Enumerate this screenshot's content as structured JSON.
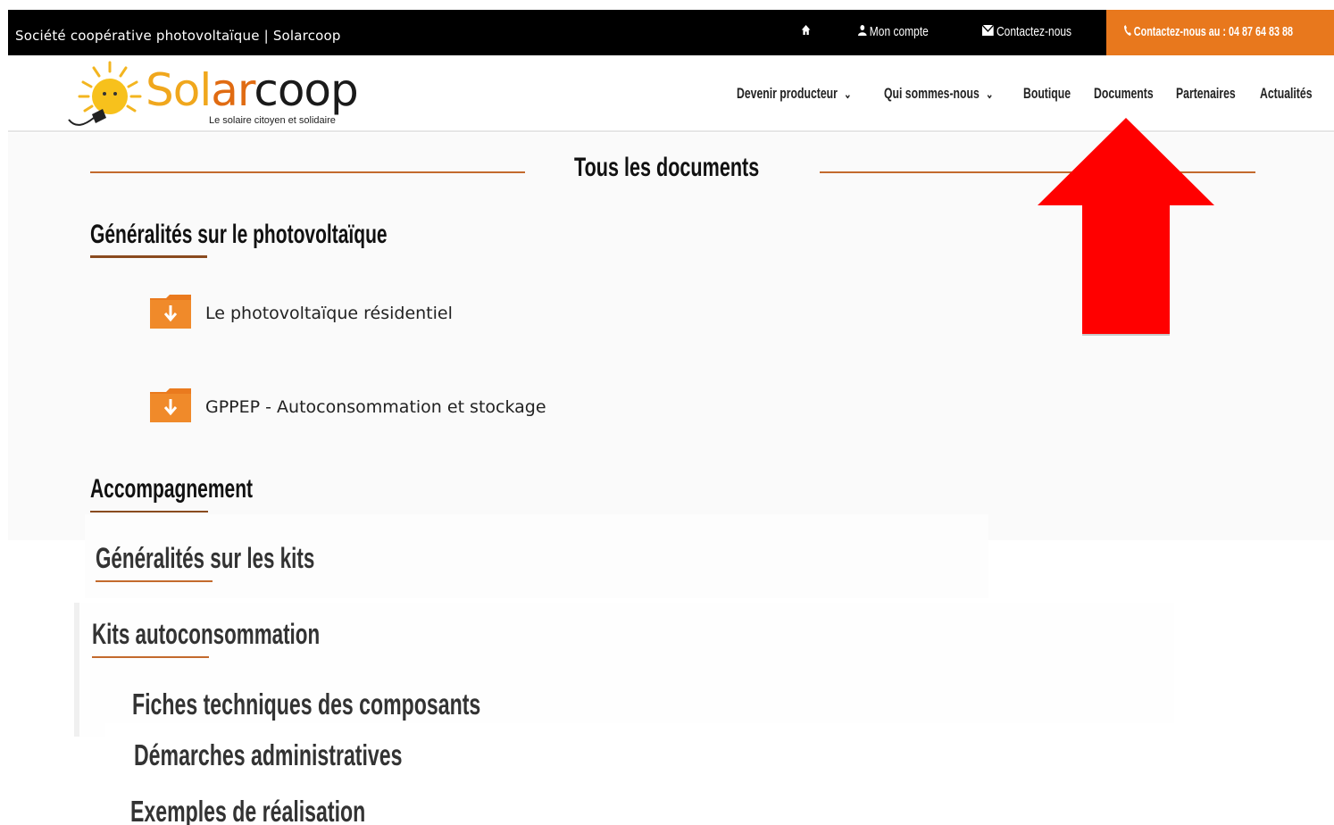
{
  "topbar": {
    "tagline": "Société coopérative photovoltaïque | Solarcoop",
    "home_icon": "home-icon",
    "account_label": "Mon compte",
    "account_icon": "user-icon",
    "contact_label": "Contactez-nous",
    "contact_icon": "envelope-icon",
    "phone_label": "Contactez-nous au : 04 87 64 83 88",
    "phone_icon": "phone-icon",
    "phone_bg": "#e8781d"
  },
  "logo": {
    "part1": "Sol",
    "part2": "ar",
    "part3": "coop",
    "slogan": "Le solaire citoyen et solidaire"
  },
  "nav": {
    "items": [
      {
        "label": "Devenir producteur",
        "has_dropdown": true
      },
      {
        "label": "Qui sommes-nous",
        "has_dropdown": true
      },
      {
        "label": "Boutique",
        "has_dropdown": false
      },
      {
        "label": "Documents",
        "has_dropdown": false
      },
      {
        "label": "Partenaires",
        "has_dropdown": false
      },
      {
        "label": "Actualités",
        "has_dropdown": false
      }
    ]
  },
  "page": {
    "title": "Tous les documents",
    "sections": [
      {
        "title": "Généralités sur le photovoltaïque",
        "documents": [
          "Le photovoltaïque résidentiel",
          "GPPEP - Autoconsommation et stockage"
        ]
      },
      {
        "title": "Accompagnement"
      }
    ],
    "lower_sections": [
      "Généralités sur les kits",
      "Kits autoconsommation",
      "Fiches techniques des composants",
      "Démarches administratives",
      "Exemples de réalisation"
    ]
  },
  "colors": {
    "accent": "#e8781d",
    "rule": "#c36a2d",
    "folder": "#ea7a1e",
    "annotation_arrow": "#ff0000"
  }
}
